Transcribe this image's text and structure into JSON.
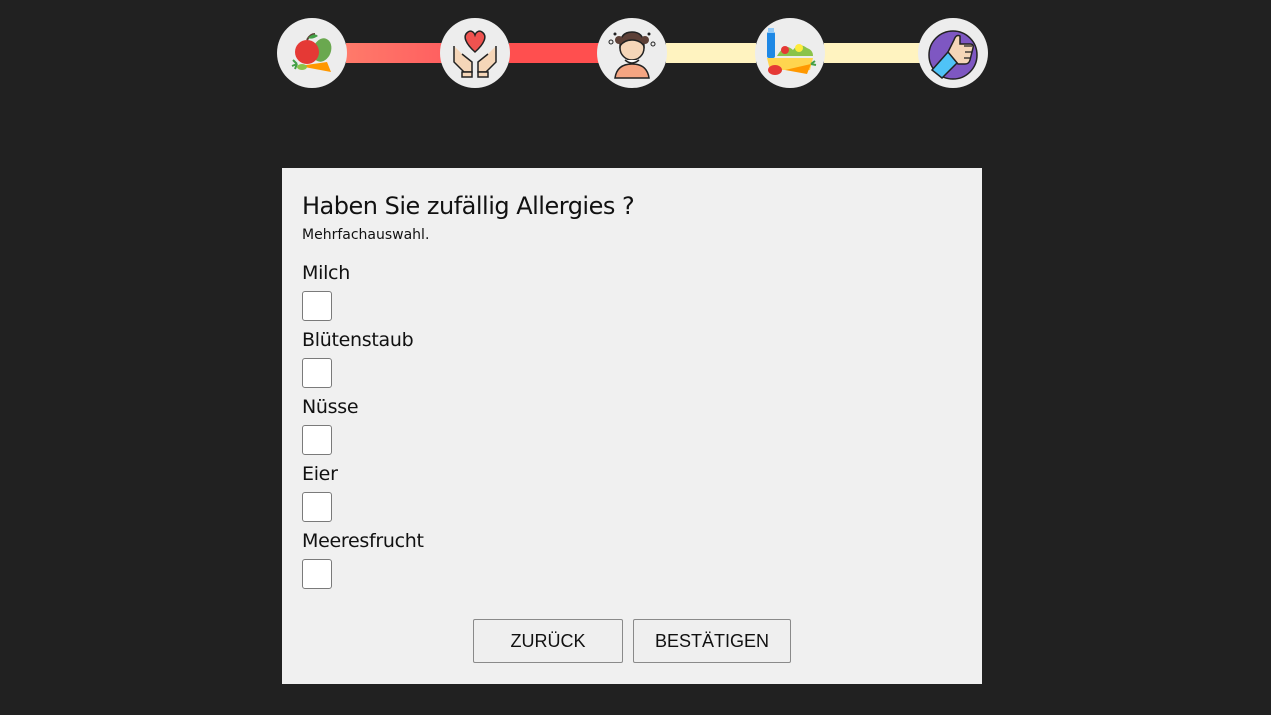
{
  "stepper": {
    "steps": [
      {
        "icon": "fruits-vegetables-icon"
      },
      {
        "icon": "hands-heart-icon"
      },
      {
        "icon": "allergy-person-icon"
      },
      {
        "icon": "groceries-icon"
      },
      {
        "icon": "thumbs-up-icon"
      }
    ],
    "connector_colors": [
      "#ff6a6a",
      "#ff4d4d",
      "#fff3c0",
      "#fff3c0"
    ],
    "completed_color": "#ff5a5a",
    "pending_color": "#fff3c0"
  },
  "form": {
    "question": "Haben Sie zufällig Allergies ?",
    "hint": "Mehrfachauswahl.",
    "options": [
      {
        "label": "Milch",
        "checked": false
      },
      {
        "label": "Blütenstaub",
        "checked": false
      },
      {
        "label": "Nüsse",
        "checked": false
      },
      {
        "label": "Eier",
        "checked": false
      },
      {
        "label": "Meeresfrucht",
        "checked": false
      }
    ],
    "back_label": "ZURÜCK",
    "confirm_label": "BESTÄTIGEN"
  }
}
